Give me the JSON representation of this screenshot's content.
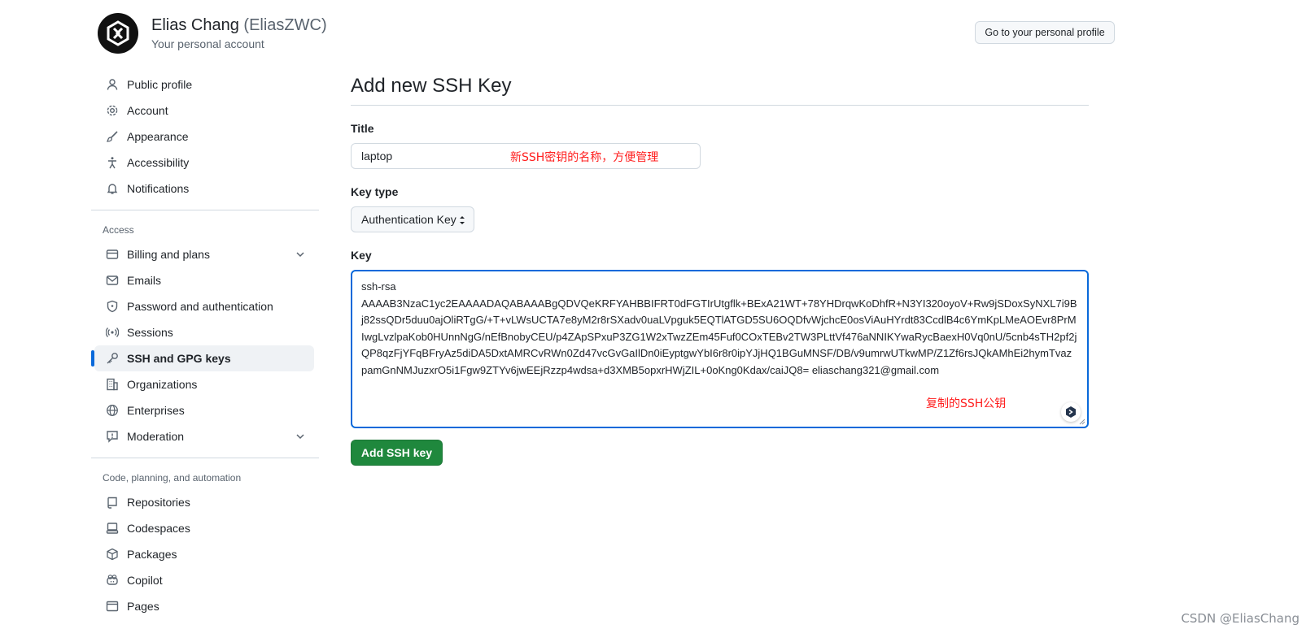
{
  "header": {
    "name": "Elias Chang",
    "handle": "(EliasZWC)",
    "subtitle": "Your personal account",
    "profile_button": "Go to your personal profile"
  },
  "sidebar": {
    "group1": [
      {
        "label": "Public profile",
        "icon": "person-icon"
      },
      {
        "label": "Account",
        "icon": "gear-icon"
      },
      {
        "label": "Appearance",
        "icon": "paintbrush-icon"
      },
      {
        "label": "Accessibility",
        "icon": "accessibility-icon"
      },
      {
        "label": "Notifications",
        "icon": "bell-icon"
      }
    ],
    "access_label": "Access",
    "group2": [
      {
        "label": "Billing and plans",
        "icon": "credit-card-icon"
      },
      {
        "label": "Emails",
        "icon": "mail-icon"
      },
      {
        "label": "Password and authentication",
        "icon": "shield-lock-icon"
      },
      {
        "label": "Sessions",
        "icon": "broadcast-icon"
      },
      {
        "label": "SSH and GPG keys",
        "icon": "key-icon"
      },
      {
        "label": "Organizations",
        "icon": "organization-icon"
      },
      {
        "label": "Enterprises",
        "icon": "globe-icon"
      },
      {
        "label": "Moderation",
        "icon": "report-icon"
      }
    ],
    "code_label": "Code, planning, and automation",
    "group3": [
      {
        "label": "Repositories",
        "icon": "repo-icon"
      },
      {
        "label": "Codespaces",
        "icon": "codespaces-icon"
      },
      {
        "label": "Packages",
        "icon": "package-icon"
      },
      {
        "label": "Copilot",
        "icon": "copilot-icon"
      },
      {
        "label": "Pages",
        "icon": "browser-icon"
      }
    ]
  },
  "form": {
    "page_title": "Add new SSH Key",
    "title_label": "Title",
    "title_value": "laptop",
    "title_annotation": "新SSH密钥的名称，方便管理",
    "key_type_label": "Key type",
    "key_type_value": "Authentication Key",
    "key_label": "Key",
    "key_value": "ssh-rsa\nAAAAB3NzaC1yc2EAAAADAQABAAABgQDVQeKRFYAHBBIFRT0dFGTIrUtgflk+BExA21WT+78YHDrqwKoDhfR+N3YI320oyoV+Rw9jSDoxSyNXL7i9Bj82ssQDr5duu0ajOliRTgG/+T+vLWsUCTA7e8yM2r8rSXadv0uaLVpguk5EQTlATGD5SU6OQDfvWjchcE0osViAuHYrdt83CcdlB4c6YmKpLMeAOEvr8PrMIwgLvzlpaKob0HUnnNgG/nEfBnobyCEU/p4ZApSPxuP3ZG1W2xTwzZEm45Fuf0COxTEBv2TW3PLttVf476aNNIKYwaRycBaexH0Vq0nU/5cnb4sTH2pf2jQP8qzFjYFqBFryAz5diDA5DxtAMRCvRWn0Zd47vcGvGaIlDn0iEyptgwYbI6r8r0ipYJjHQ1BGuMNSF/DB/v9umrwUTkwMP/Z1Zf6rsJQkAMhEi2hymTvazpamGnNMJuzxrO5i1Fgw9ZTYv6jwEEjRzzp4wdsa+d3XMB5opxrHWjZIL+0oKng0Kdax/caiJQ8= eliaschang321@gmail.com",
    "key_annotation": "复制的SSH公钥",
    "submit_label": "Add SSH key"
  },
  "watermark": "CSDN @EliasChang",
  "colors": {
    "accent": "#0969da",
    "primary_button": "#1f883d",
    "annotation": "#ff1d1d"
  }
}
